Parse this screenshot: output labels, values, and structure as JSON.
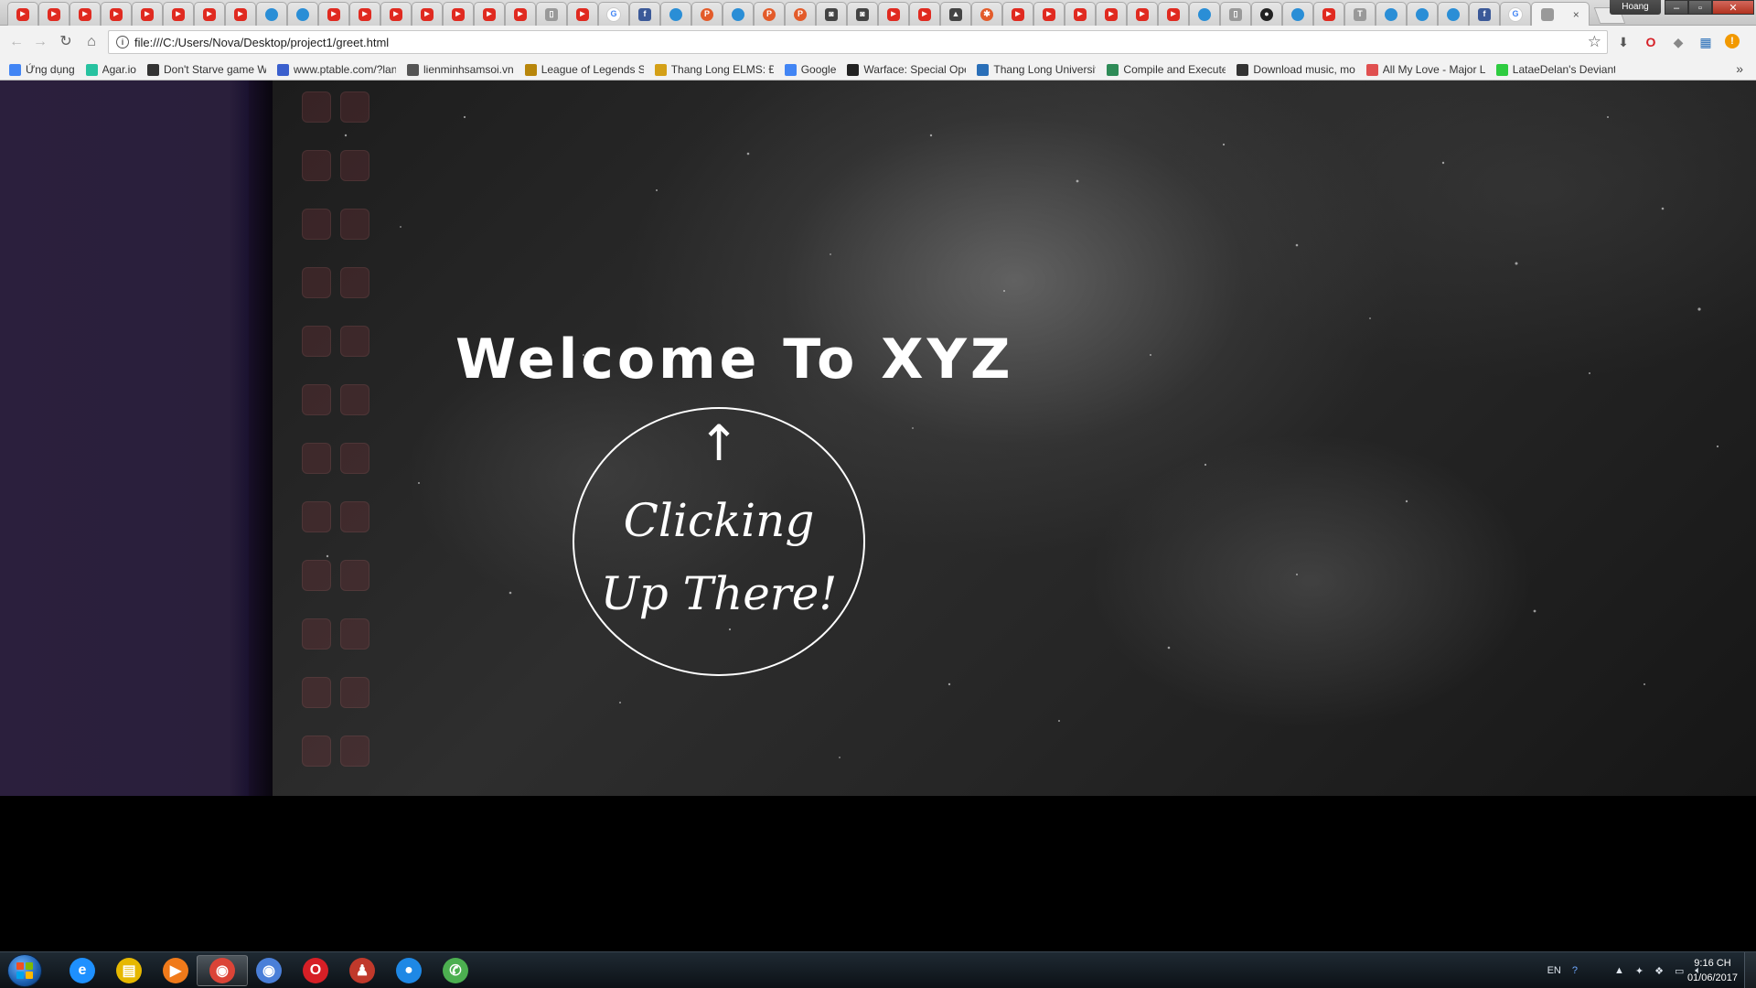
{
  "browser": {
    "url": "file:///C:/Users/Nova/Desktop/project1/greet.html",
    "profile_name": "Hoang",
    "tab_close_glyph": "×",
    "tabs_favicons": [
      "youtube-icon",
      "youtube-icon",
      "youtube-icon",
      "youtube-icon",
      "youtube-icon",
      "youtube-icon",
      "youtube-icon",
      "youtube-icon",
      "site-icon",
      "site-icon",
      "youtube-icon",
      "youtube-icon",
      "youtube-icon",
      "youtube-icon",
      "youtube-icon",
      "youtube-icon",
      "youtube-icon",
      "page-icon",
      "youtube-icon",
      "google-icon",
      "facebook-icon",
      "site-icon",
      "p-icon",
      "site-icon",
      "p-icon",
      "p-icon",
      "camera-icon",
      "camera-icon",
      "youtube-icon",
      "youtube-icon",
      "lock-icon",
      "star-icon",
      "youtube-icon",
      "youtube-icon",
      "youtube-icon",
      "youtube-icon",
      "youtube-icon",
      "youtube-icon",
      "site-icon",
      "page-icon",
      "github-icon",
      "site-icon",
      "youtube-icon",
      "tens-icon",
      "site-icon",
      "site-icon",
      "site-icon",
      "facebook-icon",
      "google-icon"
    ]
  },
  "bookmarks": [
    {
      "label": "Ứng dụng",
      "icon": "apps-grid-icon",
      "color": "#4285f4"
    },
    {
      "label": "Agar.io",
      "icon": "agar-icon",
      "color": "#27c2a0"
    },
    {
      "label": "Don't Starve game W",
      "icon": "dont-starve-icon",
      "color": "#333333"
    },
    {
      "label": "www.ptable.com/?lan",
      "icon": "ptable-icon",
      "color": "#3a5fcd"
    },
    {
      "label": "lienminhsamsoi.vn",
      "icon": "link-icon",
      "color": "#555555"
    },
    {
      "label": "League of Legends St",
      "icon": "lol-icon",
      "color": "#b8860b"
    },
    {
      "label": "Thang Long ELMS: Đă",
      "icon": "elms-icon",
      "color": "#d4a017"
    },
    {
      "label": "Google",
      "icon": "google-icon",
      "color": "#4285f4"
    },
    {
      "label": "Warface: Special Oper",
      "icon": "warface-icon",
      "color": "#222222"
    },
    {
      "label": "Thang Long University",
      "icon": "thang-long-icon",
      "color": "#2a6fb8"
    },
    {
      "label": "Compile and Execute",
      "icon": "code-icon",
      "color": "#2e8b57"
    },
    {
      "label": "Download music, mo",
      "icon": "download-icon",
      "color": "#333333"
    },
    {
      "label": "All My Love - Major L",
      "icon": "music-icon",
      "color": "#e05050"
    },
    {
      "label": "LataeDelan's Deviant",
      "icon": "deviantart-icon",
      "color": "#2ecc40"
    }
  ],
  "bookmarks_more": "»",
  "page": {
    "title": "Welcome To XYZ",
    "cta_arrow": "↑",
    "cta_line1": "Clicking",
    "cta_line2": "Up There!"
  },
  "taskbar": {
    "apps": [
      {
        "name": "internet-explorer-icon",
        "glyph": "e",
        "color": "#1e90ff"
      },
      {
        "name": "file-explorer-icon",
        "glyph": "▤",
        "color": "#e6b800"
      },
      {
        "name": "media-player-icon",
        "glyph": "▶",
        "color": "#f07a1a"
      },
      {
        "name": "chrome-icon",
        "glyph": "◉",
        "color": "#db4437"
      },
      {
        "name": "chromium-icon",
        "glyph": "◉",
        "color": "#4a7fd8"
      },
      {
        "name": "opera-icon",
        "glyph": "O",
        "color": "#d61f26"
      },
      {
        "name": "game-icon",
        "glyph": "♟",
        "color": "#c0392b"
      },
      {
        "name": "chat-icon",
        "glyph": "●",
        "color": "#1e88e5"
      },
      {
        "name": "messenger-icon",
        "glyph": "✆",
        "color": "#4caf50"
      }
    ],
    "lang": "EN",
    "time": "9:16 CH",
    "date": "01/06/2017"
  },
  "colors": {
    "page_text": "#ffffff",
    "left_panel": "#2b1f3d",
    "taskbar": "#141b22"
  }
}
